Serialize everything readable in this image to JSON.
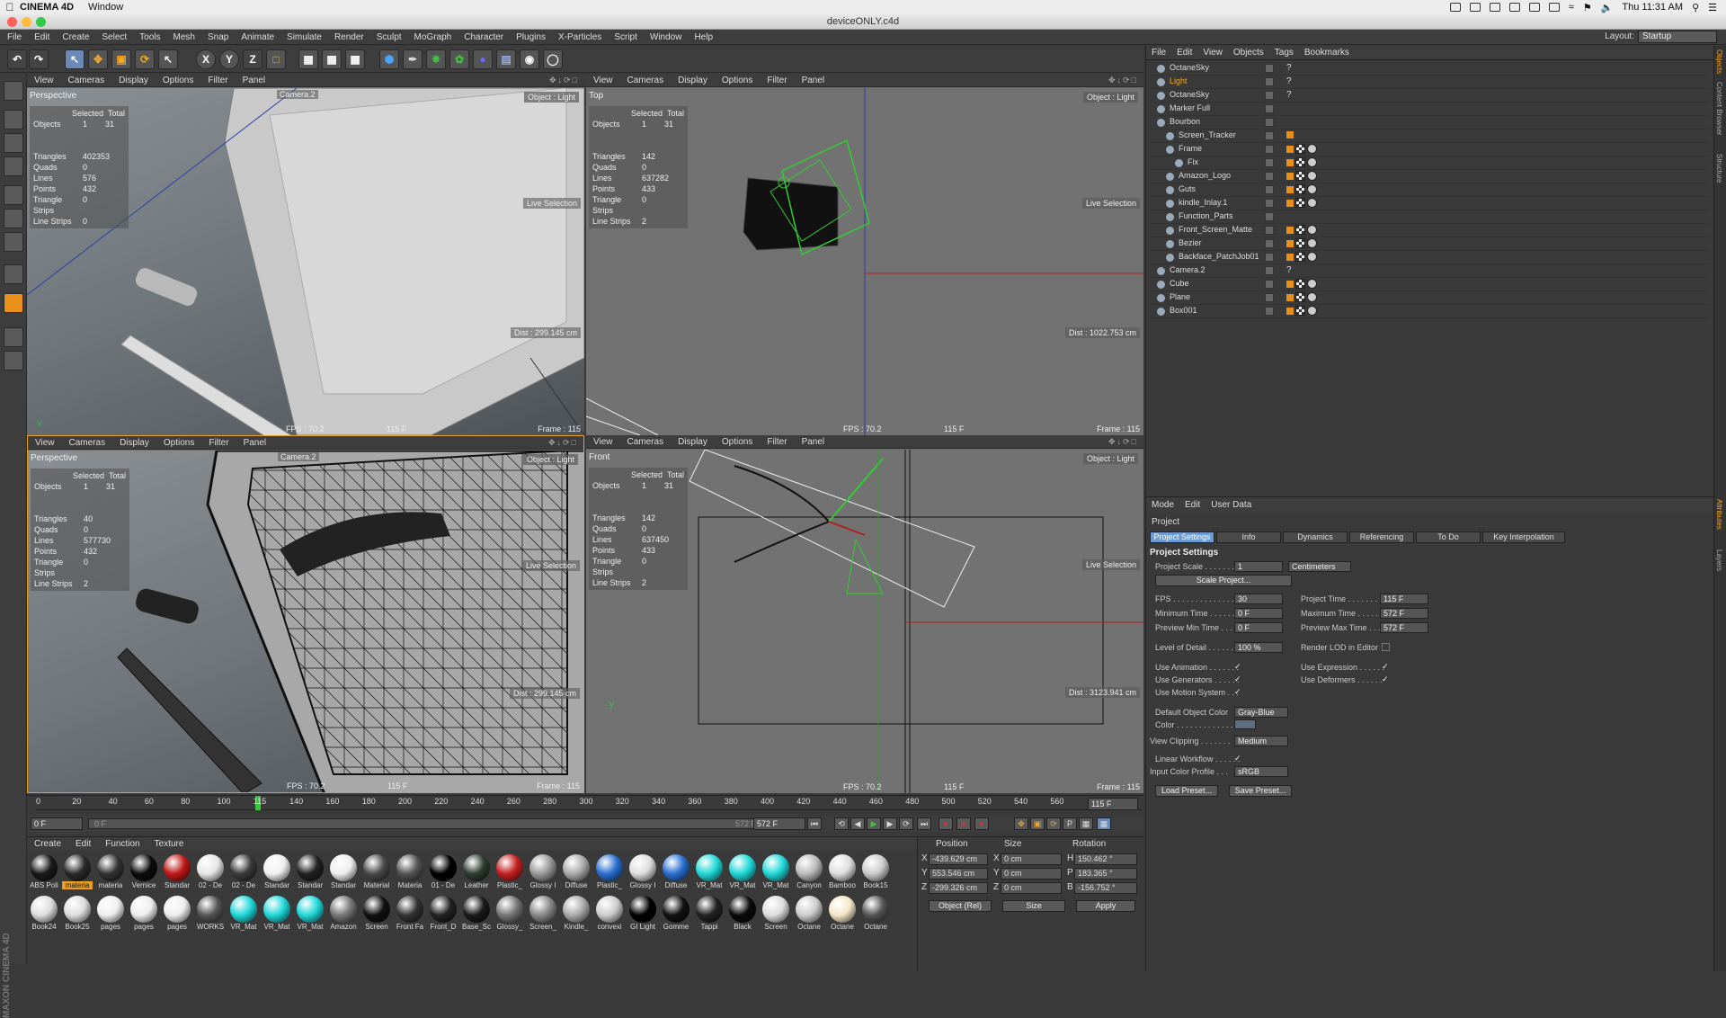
{
  "macbar": {
    "app_name": "CINEMA 4D",
    "menu": [
      "Window"
    ],
    "clock": "Thu 11:31 AM"
  },
  "window": {
    "title": "deviceONLY.c4d"
  },
  "menu": [
    "File",
    "Edit",
    "Create",
    "Select",
    "Tools",
    "Mesh",
    "Snap",
    "Animate",
    "Simulate",
    "Render",
    "Sculpt",
    "MoGraph",
    "Character",
    "Plugins",
    "X-Particles",
    "Script",
    "Window",
    "Help"
  ],
  "layout": {
    "label": "Layout:",
    "value": "Startup"
  },
  "toolbar": {
    "x": "X",
    "y": "Y",
    "z": "Z"
  },
  "viewport_menu": [
    "View",
    "Cameras",
    "Display",
    "Options",
    "Filter",
    "Panel"
  ],
  "viewports": [
    {
      "name": "Perspective",
      "camera": "Camera.2",
      "stats_header": [
        "Selected",
        "Total"
      ],
      "objects": [
        "1",
        "31"
      ],
      "stats": [
        [
          "Triangles",
          "402353"
        ],
        [
          "Quads",
          "0"
        ],
        [
          "Lines",
          "576"
        ],
        [
          "Points",
          "432"
        ],
        [
          "Triangle Strips",
          "0"
        ],
        [
          "Line Strips",
          "0"
        ]
      ],
      "object_light": "Object : Light",
      "live_selection": "Live Selection",
      "dist": "Dist : 299.145 cm",
      "fps": "FPS : 70.2",
      "frame_left": "115 F",
      "frame": "Frame : 115"
    },
    {
      "name": "Top",
      "stats_header": [
        "Selected",
        "Total"
      ],
      "objects": [
        "1",
        "31"
      ],
      "stats": [
        [
          "Triangles",
          "142"
        ],
        [
          "Quads",
          "0"
        ],
        [
          "Lines",
          "637282"
        ],
        [
          "Points",
          "433"
        ],
        [
          "Triangle Strips",
          "0"
        ],
        [
          "Line Strips",
          "2"
        ]
      ],
      "object_light": "Object : Light",
      "live_selection": "Live Selection",
      "dist": "Dist : 1022.753 cm",
      "fps": "FPS : 70.2",
      "frame_left": "115 F",
      "frame": "Frame : 115"
    },
    {
      "name": "Perspective",
      "camera": "Camera.2",
      "stats_header": [
        "Selected",
        "Total"
      ],
      "objects": [
        "1",
        "31"
      ],
      "stats": [
        [
          "Triangles",
          "40"
        ],
        [
          "Quads",
          "0"
        ],
        [
          "Lines",
          "577730"
        ],
        [
          "Points",
          "432"
        ],
        [
          "Triangle Strips",
          "0"
        ],
        [
          "Line Strips",
          "2"
        ]
      ],
      "object_light": "Object : Light",
      "live_selection": "Live Selection",
      "dist": "Dist : 299.145 cm",
      "fps": "FPS : 70.2",
      "frame_left": "115 F",
      "frame": "Frame : 115"
    },
    {
      "name": "Front",
      "stats_header": [
        "Selected",
        "Total"
      ],
      "objects": [
        "1",
        "31"
      ],
      "stats": [
        [
          "Triangles",
          "142"
        ],
        [
          "Quads",
          "0"
        ],
        [
          "Lines",
          "637450"
        ],
        [
          "Points",
          "433"
        ],
        [
          "Triangle Strips",
          "0"
        ],
        [
          "Line Strips",
          "2"
        ]
      ],
      "object_light": "Object : Light",
      "live_selection": "Live Selection",
      "dist": "Dist : 3123.941 cm",
      "fps": "FPS : 70.2",
      "frame_left": "115 F",
      "frame": "Frame : 115"
    }
  ],
  "objects_label": "Objects",
  "timeline": {
    "ticks": [
      "0",
      "20",
      "40",
      "60",
      "80",
      "100",
      "115",
      "140",
      "160",
      "180",
      "200",
      "220",
      "240",
      "260",
      "280",
      "300",
      "320",
      "340",
      "360",
      "380",
      "400",
      "420",
      "440",
      "460",
      "480",
      "500",
      "520",
      "540",
      "560"
    ],
    "current_frame": "115 F",
    "start": "0 F",
    "range_start": "0 F",
    "range_end": "572 F",
    "end": "572 F"
  },
  "material_menu": [
    "Create",
    "Edit",
    "Function",
    "Texture"
  ],
  "materials": [
    {
      "label": "ABS Poli",
      "color": "#1a1a1a"
    },
    {
      "label": "materia",
      "color": "#2a2a2a",
      "selected": true
    },
    {
      "label": "materia",
      "color": "#333"
    },
    {
      "label": "Vernice",
      "color": "#0c0c0c"
    },
    {
      "label": "Standar",
      "color": "#c01818"
    },
    {
      "label": "02 - De",
      "color": "#e6e6e6"
    },
    {
      "label": "02 - De",
      "color": "#3a3a3a"
    },
    {
      "label": "Standar",
      "color": "#f0f0f0"
    },
    {
      "label": "Standar",
      "color": "#222"
    },
    {
      "label": "Standar",
      "color": "#eee"
    },
    {
      "label": "Material",
      "color": "#4a4a4a"
    },
    {
      "label": "Materia",
      "color": "#555"
    },
    {
      "label": "01 - De",
      "color": "#000"
    },
    {
      "label": "Leather",
      "color": "#2e3b30"
    },
    {
      "label": "Plastic_",
      "color": "#c52020"
    },
    {
      "label": "Glossy I",
      "color": "#999"
    },
    {
      "label": "Diffuse",
      "color": "#aaa"
    },
    {
      "label": "Plastic_",
      "color": "#2a6fd0"
    },
    {
      "label": "Glossy I",
      "color": "#ddd"
    },
    {
      "label": "Diffuse",
      "color": "#2a6fd0"
    },
    {
      "label": "VR_Mat",
      "color": "#20d8d8"
    },
    {
      "label": "VR_Mat",
      "color": "#20d8d8"
    },
    {
      "label": "VR_Mat",
      "color": "#20d8d8"
    },
    {
      "label": "Canyon",
      "color": "#bbb"
    },
    {
      "label": "Bamboo",
      "color": "#ddd"
    },
    {
      "label": "Book15",
      "color": "#ccc"
    },
    {
      "label": "Book24",
      "color": "#ddd"
    },
    {
      "label": "Book25",
      "color": "#ddd"
    },
    {
      "label": "pages",
      "color": "#eee"
    },
    {
      "label": "pages",
      "color": "#eee"
    },
    {
      "label": "pages",
      "color": "#eee"
    },
    {
      "label": "WORKS",
      "color": "#555"
    },
    {
      "label": "VR_Mat",
      "color": "#20d8d8"
    },
    {
      "label": "VR_Mat",
      "color": "#20d8d8"
    },
    {
      "label": "VR_Mat",
      "color": "#20d8d8"
    },
    {
      "label": "Amazon",
      "color": "#777"
    },
    {
      "label": "Screen",
      "color": "#111"
    },
    {
      "label": "Front Fa",
      "color": "#333"
    },
    {
      "label": "Front_D",
      "color": "#222"
    },
    {
      "label": "Base_Sc",
      "color": "#1a1a1a"
    },
    {
      "label": "Glossy_",
      "color": "#777"
    },
    {
      "label": "Screen_",
      "color": "#888"
    },
    {
      "label": "Kindle_",
      "color": "#aaa"
    },
    {
      "label": "convexi",
      "color": "#ccc"
    },
    {
      "label": "GI Light",
      "color": "#000"
    },
    {
      "label": "Gomme",
      "color": "#111"
    },
    {
      "label": "Tappi",
      "color": "#222"
    },
    {
      "label": "Black",
      "color": "#0a0a0a"
    },
    {
      "label": "Screen",
      "color": "#ddd"
    },
    {
      "label": "Octane",
      "color": "#ccc"
    },
    {
      "label": "Octane",
      "color": "#f5e8c8"
    },
    {
      "label": "Octane",
      "color": "#555"
    }
  ],
  "coords": {
    "headers": [
      "Position",
      "Size",
      "Rotation"
    ],
    "rows": [
      {
        "axis": "X",
        "pos": "-439.629 cm",
        "size_axis": "X",
        "size": "0 cm",
        "rot_axis": "H",
        "rot": "150.462 °"
      },
      {
        "axis": "Y",
        "pos": "553.546 cm",
        "size_axis": "Y",
        "size": "0 cm",
        "rot_axis": "P",
        "rot": "183.365 °"
      },
      {
        "axis": "Z",
        "pos": "-299.326 cm",
        "size_axis": "Z",
        "size": "0 cm",
        "rot_axis": "B",
        "rot": "-156.752 °"
      }
    ],
    "mode": "Object (Rel)",
    "size_mode": "Size",
    "apply": "Apply"
  },
  "objmgr": {
    "menu": [
      "File",
      "Edit",
      "View",
      "Objects",
      "Tags",
      "Bookmarks"
    ],
    "items": [
      {
        "name": "OctaneSky",
        "indent": 0,
        "tags": "?"
      },
      {
        "name": "Light",
        "indent": 0,
        "tags": "?",
        "highlight": true
      },
      {
        "name": "OctaneSky",
        "indent": 0,
        "tags": "?"
      },
      {
        "name": "Marker Full",
        "indent": 0,
        "tags": ""
      },
      {
        "name": "Bourbon",
        "indent": 0,
        "tags": ""
      },
      {
        "name": "Screen_Tracker",
        "indent": 1,
        "tags": "orange"
      },
      {
        "name": "Frame",
        "indent": 1,
        "tags": "mix"
      },
      {
        "name": "Fix",
        "indent": 2,
        "tags": "mix"
      },
      {
        "name": "Amazon_Logo",
        "indent": 1,
        "tags": "mix"
      },
      {
        "name": "Guts",
        "indent": 1,
        "tags": "mix"
      },
      {
        "name": "kindle_Inlay.1",
        "indent": 1,
        "tags": "mix"
      },
      {
        "name": "Function_Parts",
        "indent": 1,
        "tags": ""
      },
      {
        "name": "Front_Screen_Matte",
        "indent": 1,
        "tags": "mix"
      },
      {
        "name": "Bezier",
        "indent": 1,
        "tags": "mix"
      },
      {
        "name": "Backface_PatchJob01",
        "indent": 1,
        "tags": "mix"
      },
      {
        "name": "Camera.2",
        "indent": 0,
        "tags": "?"
      },
      {
        "name": "Cube",
        "indent": 0,
        "tags": "mix"
      },
      {
        "name": "Plane",
        "indent": 0,
        "tags": "mix"
      },
      {
        "name": "Box001",
        "indent": 0,
        "tags": "mix"
      }
    ]
  },
  "attrmgr": {
    "menu": [
      "Mode",
      "Edit",
      "User Data"
    ],
    "object_label": "Project",
    "tabs": [
      "Project Settings",
      "Info",
      "Dynamics",
      "Referencing",
      "To Do",
      "Key Interpolation"
    ],
    "section": "Project Settings",
    "project_scale_label": "Project Scale . . . . . . .",
    "project_scale": "1",
    "project_scale_unit": "Centimeters",
    "scale_project": "Scale Project...",
    "fps_label": "FPS . . . . . . . . . . . . . . .",
    "fps": "30",
    "project_time_label": "Project Time . . . . . . . .",
    "project_time": "115 F",
    "min_time_label": "Minimum Time . . . . . . .",
    "min_time": "0 F",
    "max_time_label": "Maximum Time . . . . . .",
    "max_time": "572 F",
    "prev_min_label": "Preview Min Time . . . .",
    "prev_min": "0 F",
    "prev_max_label": "Preview Max Time . . .",
    "prev_max": "572 F",
    "lod_label": "Level of Detail . . . . . . .",
    "lod": "100 %",
    "render_lod_label": "Render LOD in Editor",
    "use_anim": "Use Animation . . . . . . .",
    "use_expr": "Use Expression . . . . . .",
    "use_gen": "Use Generators . . . . . .",
    "use_deform": "Use Deformers . . . . . .",
    "use_motion": "Use Motion System . . .",
    "def_color_label": "Default Object Color",
    "def_color": "Gray-Blue",
    "color_label": "Color . . . . . . . . . . . . . .",
    "view_clip_label": "View Clipping . . . . . . .",
    "view_clip": "Medium",
    "linear_label": "Linear Workflow . . . . . .",
    "input_profile_label": "Input Color Profile . . .",
    "input_profile": "sRGB",
    "load_preset": "Load Preset...",
    "save_preset": "Save Preset..."
  },
  "right_tabs": [
    "Objects",
    "Content Browser",
    "Structure",
    "Attributes",
    "Layers"
  ]
}
